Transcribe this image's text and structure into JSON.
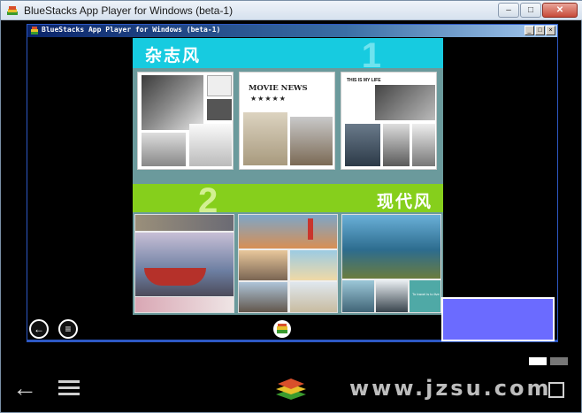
{
  "window": {
    "title": "BlueStacks App Player for Windows (beta-1)",
    "buttons": {
      "minimize": "–",
      "maximize": "□",
      "close": "✕"
    }
  },
  "inner_window": {
    "title": "BlueStacks App Player for Windows (beta-1)",
    "buttons": {
      "minimize": "_",
      "maximize": "□",
      "close": "×"
    }
  },
  "content": {
    "section1": {
      "title": "杂志风",
      "number": "1"
    },
    "section2": {
      "title": "现代风",
      "number": "2"
    },
    "tile_movie": {
      "heading": "MOVIE NEWS",
      "stars": "★★★★★"
    },
    "tile_magazine3": {
      "text": "THIS IS MY LIFE"
    },
    "tile_quote": {
      "text": "To travel is to live"
    }
  },
  "navigation": {
    "inner_back": "←",
    "inner_menu": "≡",
    "bottom_back": "←"
  },
  "watermark": "www.jzsu.com",
  "colors": {
    "section1_accent": "#17cbe0",
    "section2_accent": "#86cf1c",
    "overlay": "#6b6bff",
    "panel_bg": "#6b9a9c"
  },
  "icons": [
    "bluestacks-logo-icon",
    "back-arrow-icon",
    "menu-lines-icon",
    "home-icon",
    "fullscreen-icon"
  ]
}
